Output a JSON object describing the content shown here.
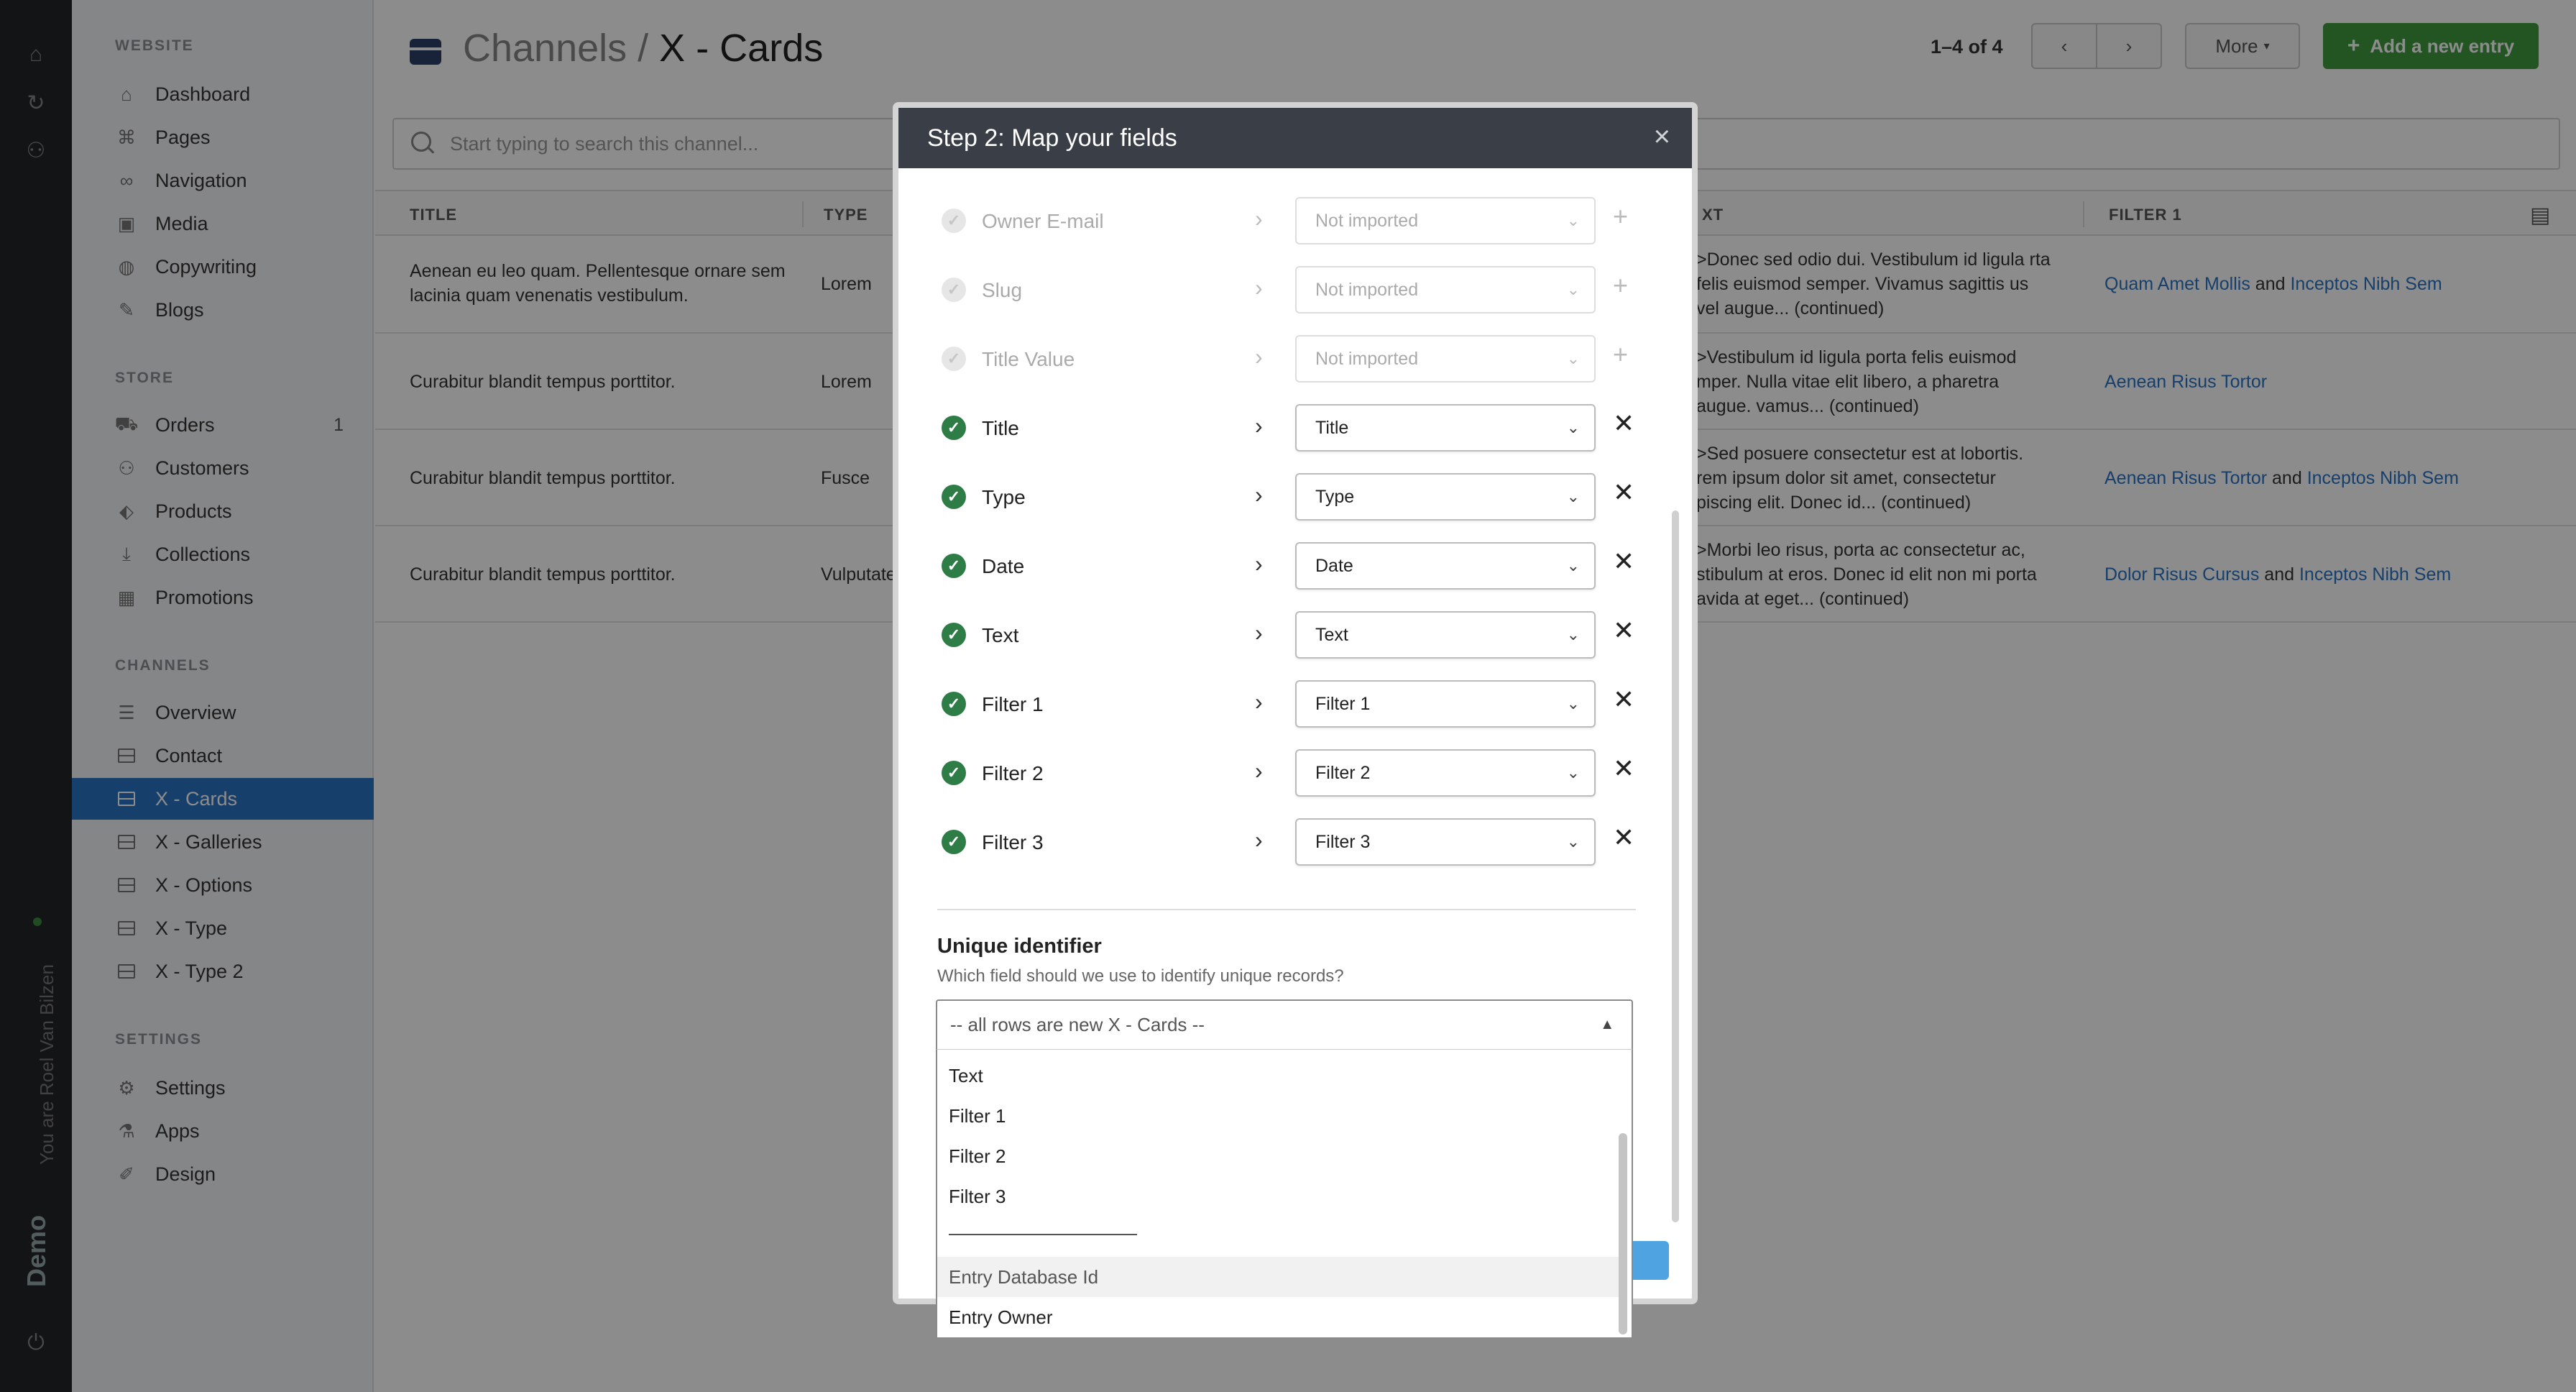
{
  "rail": {
    "user_text": "You are Roel Van Bilzen",
    "env_text": "Demo"
  },
  "sidebar": {
    "website_heading": "WEBSITE",
    "website_items": [
      {
        "label": "Dashboard",
        "icon": "home-icon"
      },
      {
        "label": "Pages",
        "icon": "sitemap-icon"
      },
      {
        "label": "Navigation",
        "icon": "link-icon"
      },
      {
        "label": "Media",
        "icon": "images-icon"
      },
      {
        "label": "Copywriting",
        "icon": "globe-icon"
      },
      {
        "label": "Blogs",
        "icon": "feather-icon"
      }
    ],
    "store_heading": "STORE",
    "store_items": [
      {
        "label": "Orders",
        "icon": "cart-icon",
        "badge": "1"
      },
      {
        "label": "Customers",
        "icon": "users-icon"
      },
      {
        "label": "Products",
        "icon": "tags-icon"
      },
      {
        "label": "Collections",
        "icon": "download-icon"
      },
      {
        "label": "Promotions",
        "icon": "calendar-icon"
      }
    ],
    "channels_heading": "CHANNELS",
    "channel_items": [
      {
        "label": "Overview",
        "icon": "database-icon"
      },
      {
        "label": "Contact",
        "icon": "box-icon"
      },
      {
        "label": "X - Cards",
        "icon": "box-icon",
        "active": true
      },
      {
        "label": "X - Galleries",
        "icon": "box-icon"
      },
      {
        "label": "X - Options",
        "icon": "box-icon"
      },
      {
        "label": "X - Type",
        "icon": "box-icon"
      },
      {
        "label": "X - Type 2",
        "icon": "box-icon"
      }
    ],
    "settings_heading": "SETTINGS",
    "settings_items": [
      {
        "label": "Settings",
        "icon": "gear-icon"
      },
      {
        "label": "Apps",
        "icon": "flask-icon"
      },
      {
        "label": "Design",
        "icon": "pencil-ruler-icon"
      }
    ]
  },
  "header": {
    "crumb": "Channels",
    "separator": " / ",
    "title": "X - Cards",
    "pager_count": "1–4 of 4",
    "more_label": "More",
    "add_label": "Add a new entry"
  },
  "search": {
    "placeholder": "Start typing to search this channel..."
  },
  "table": {
    "columns": [
      "TITLE",
      "TYPE",
      "XT",
      "FILTER 1"
    ],
    "rows": [
      {
        "title": "Aenean eu leo quam. Pellentesque ornare sem lacinia quam venenatis vestibulum.",
        "type": "Lorem",
        "text": ">Donec sed odio dui. Vestibulum id ligula rta felis euismod semper. Vivamus sagittis us vel augue... (continued)",
        "filter_a": "Quam Amet Mollis",
        "and": "and",
        "filter_b": "Inceptos Nibh Sem"
      },
      {
        "title": "Curabitur blandit tempus porttitor.",
        "type": "Lorem",
        "text": ">Vestibulum id ligula porta felis euismod mper. Nulla vitae elit libero, a pharetra augue. vamus... (continued)",
        "filter_a": "Aenean Risus Tortor",
        "and": "",
        "filter_b": ""
      },
      {
        "title": "Curabitur blandit tempus porttitor.",
        "type": "Fusce",
        "text": ">Sed posuere consectetur est at lobortis. rem ipsum dolor sit amet, consectetur piscing elit. Donec id... (continued)",
        "filter_a": "Aenean Risus Tortor",
        "and": "and",
        "filter_b": "Inceptos Nibh Sem"
      },
      {
        "title": "Curabitur blandit tempus porttitor.",
        "type": "Vulputate",
        "text": ">Morbi leo risus, porta ac consectetur ac, stibulum at eros. Donec id elit non mi porta avida at eget... (continued)",
        "filter_a": "Dolor Risus Cursus",
        "and": "and",
        "filter_b": "Inceptos Nibh Sem"
      }
    ]
  },
  "modal": {
    "title": "Step 2: Map your fields",
    "close": "×",
    "fields": [
      {
        "label": "Owner E-mail",
        "mapped": false,
        "value": "Not imported"
      },
      {
        "label": "Slug",
        "mapped": false,
        "value": "Not imported"
      },
      {
        "label": "Title Value",
        "mapped": false,
        "value": "Not imported"
      },
      {
        "label": "Title",
        "mapped": true,
        "value": "Title"
      },
      {
        "label": "Type",
        "mapped": true,
        "value": "Type"
      },
      {
        "label": "Date",
        "mapped": true,
        "value": "Date"
      },
      {
        "label": "Text",
        "mapped": true,
        "value": "Text"
      },
      {
        "label": "Filter 1",
        "mapped": true,
        "value": "Filter 1"
      },
      {
        "label": "Filter 2",
        "mapped": true,
        "value": "Filter 2"
      },
      {
        "label": "Filter 3",
        "mapped": true,
        "value": "Filter 3"
      }
    ],
    "unique_title": "Unique identifier",
    "unique_help": "Which field should we use to identify unique records?",
    "unique_selected": "-- all rows are new X - Cards --",
    "unique_options": [
      "Text",
      "Filter 1",
      "Filter 2",
      "Filter 3",
      "Entry Database Id",
      "Entry Owner"
    ],
    "hovered_option": "Entry Database Id"
  },
  "colors": {
    "active_nav": "#2a73c5",
    "add_button": "#3e9b3e",
    "mapped_check": "#2e7d46",
    "link": "#2a73c5"
  }
}
